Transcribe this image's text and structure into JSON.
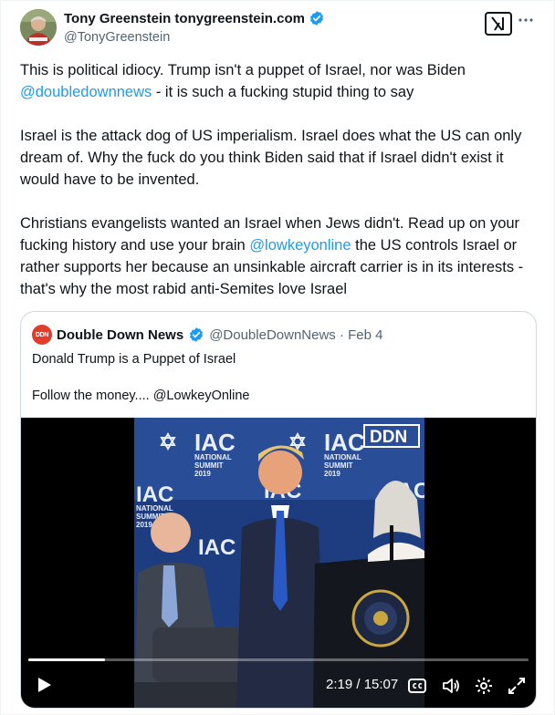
{
  "author": {
    "display_name": "Tony Greenstein tonygreenstein.com",
    "handle": "@TonyGreenstein"
  },
  "icons": {
    "verified": "verified-badge-icon",
    "grok": "grok-icon",
    "more": "more-icon"
  },
  "post": {
    "p1": {
      "t1": "This is political idiocy.   Trump isn't a  puppet of Israel, nor was Biden ",
      "mention": "@doubledownnews",
      "t2": " - it is such a fucking stupid thing to say"
    },
    "p2": "Israel is the attack dog of US imperialism. Israel does what the US can only dream of. Why the fuck do you think Biden said that if Israel didn't exist it would have to be invented.",
    "p3": {
      "t1": "Christians evangelists wanted an Israel when Jews didn't. Read up on your fucking history and use your brain ",
      "mention": "@lowkeyonline",
      "t2": " the US controls Israel or rather supports her because an unsinkable aircraft carrier is in its interests - that's why the most rabid anti-Semites love Israel"
    }
  },
  "quote": {
    "avatar_text": "DDN",
    "name": "Double Down News",
    "handle_date": "@DoubleDownNews · Feb 4",
    "line1": "Donald Trump is a Puppet of Israel",
    "line2": "Follow the money.... @LowkeyOnline"
  },
  "video": {
    "backdrop_text": "IAC",
    "backdrop_sub1": "NATIONAL",
    "backdrop_sub2": "SUMMIT",
    "backdrop_year": "2019",
    "watermark": "DDN",
    "time": "2:19 / 15:07",
    "progress": 0.153,
    "controls": [
      "play-icon",
      "captions-icon",
      "volume-icon",
      "settings-icon",
      "fullscreen-icon"
    ]
  },
  "colors": {
    "link": "#1d9bf0",
    "text": "#0f1419",
    "secondary": "#536471",
    "border": "#cfd9de"
  }
}
